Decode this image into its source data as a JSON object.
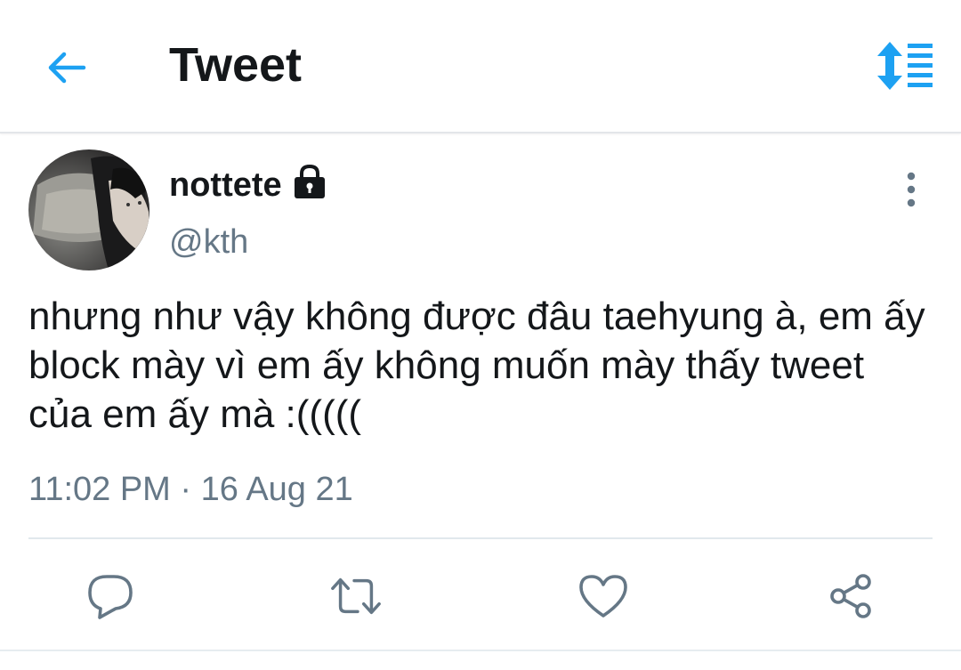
{
  "header": {
    "title": "Tweet",
    "back_icon": "arrow-left-icon",
    "sort_icon": "sort-lines-icon",
    "accent_color": "#1da1f2"
  },
  "tweet": {
    "author": {
      "display_name": "nottete",
      "handle": "@kth",
      "protected": true,
      "lock_icon": "lock-icon",
      "avatar": "profile-photo"
    },
    "text": "nhưng như vậy không được đâu taehyung à, em ấy block mày vì em ấy không muốn mày thấy tweet của em ấy mà :(((((",
    "timestamp": "11:02 PM · 16 Aug 21",
    "more_icon": "more-vertical-icon"
  },
  "actions": [
    {
      "name": "reply",
      "icon": "reply-bubble-icon"
    },
    {
      "name": "retweet",
      "icon": "retweet-icon"
    },
    {
      "name": "like",
      "icon": "heart-icon"
    },
    {
      "name": "share",
      "icon": "share-icon"
    }
  ],
  "colors": {
    "text_primary": "#14171a",
    "text_secondary": "#657786",
    "icon_gray": "#657786",
    "divider": "#e1e8ed"
  }
}
